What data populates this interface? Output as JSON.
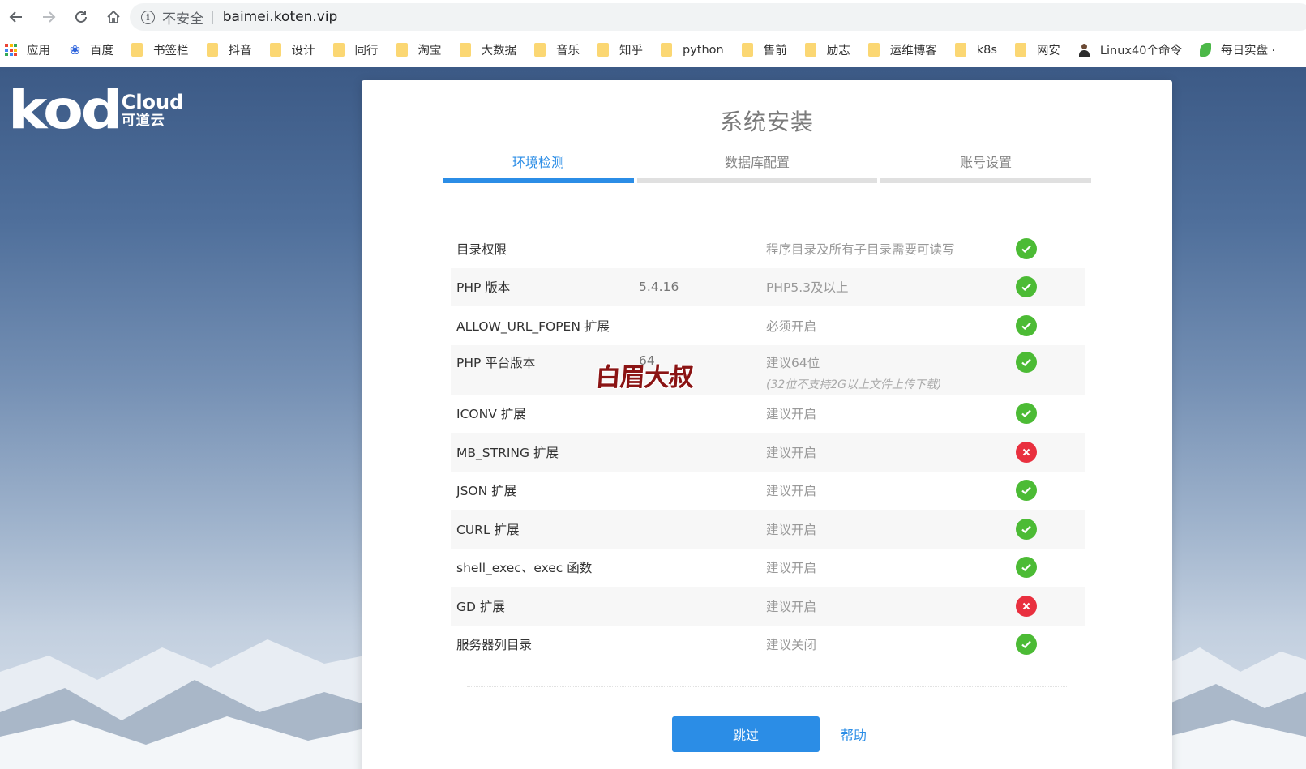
{
  "browser": {
    "insecure_label": "不安全",
    "separator": "|",
    "url": "baimei.koten.vip",
    "bookmarks": [
      {
        "label": "应用",
        "icon": "apps-grid-icon"
      },
      {
        "label": "百度",
        "icon": "baidu-paw-icon"
      },
      {
        "label": "书签栏",
        "icon": "folder-icon"
      },
      {
        "label": "抖音",
        "icon": "folder-icon"
      },
      {
        "label": "设计",
        "icon": "folder-icon"
      },
      {
        "label": "同行",
        "icon": "folder-icon"
      },
      {
        "label": "淘宝",
        "icon": "folder-icon"
      },
      {
        "label": "大数据",
        "icon": "folder-icon"
      },
      {
        "label": "音乐",
        "icon": "folder-icon"
      },
      {
        "label": "知乎",
        "icon": "folder-icon"
      },
      {
        "label": "python",
        "icon": "folder-icon"
      },
      {
        "label": "售前",
        "icon": "folder-icon"
      },
      {
        "label": "励志",
        "icon": "folder-icon"
      },
      {
        "label": "运维博客",
        "icon": "folder-icon"
      },
      {
        "label": "k8s",
        "icon": "folder-icon"
      },
      {
        "label": "网安",
        "icon": "folder-icon"
      },
      {
        "label": "Linux40个命令",
        "icon": "person-icon"
      },
      {
        "label": "每日实盘 ·",
        "icon": "leaf-icon"
      }
    ]
  },
  "logo": {
    "mark": "kod",
    "cloud": "Cloud",
    "cn": "可道云"
  },
  "installer": {
    "title": "系统安装",
    "steps": [
      {
        "label": "环境检测",
        "active": true
      },
      {
        "label": "数据库配置",
        "active": false
      },
      {
        "label": "账号设置",
        "active": false
      }
    ],
    "checks": [
      {
        "name": "目录权限",
        "value": "",
        "requirement": "程序目录及所有子目录需要可读写",
        "note": "",
        "status": "ok"
      },
      {
        "name": "PHP 版本",
        "value": "5.4.16",
        "requirement": "PHP5.3及以上",
        "note": "",
        "status": "ok"
      },
      {
        "name": "ALLOW_URL_FOPEN 扩展",
        "value": "",
        "requirement": "必须开启",
        "note": "",
        "status": "ok"
      },
      {
        "name": "PHP 平台版本",
        "value": "64",
        "requirement": "建议64位",
        "note": "(32位不支持2G以上文件上传下载)",
        "status": "ok"
      },
      {
        "name": "ICONV 扩展",
        "value": "",
        "requirement": "建议开启",
        "note": "",
        "status": "ok"
      },
      {
        "name": "MB_STRING 扩展",
        "value": "",
        "requirement": "建议开启",
        "note": "",
        "status": "fail"
      },
      {
        "name": "JSON 扩展",
        "value": "",
        "requirement": "建议开启",
        "note": "",
        "status": "ok"
      },
      {
        "name": "CURL 扩展",
        "value": "",
        "requirement": "建议开启",
        "note": "",
        "status": "ok"
      },
      {
        "name": "shell_exec、exec 函数",
        "value": "",
        "requirement": "建议开启",
        "note": "",
        "status": "ok"
      },
      {
        "name": "GD 扩展",
        "value": "",
        "requirement": "建议开启",
        "note": "",
        "status": "fail"
      },
      {
        "name": "服务器列目录",
        "value": "",
        "requirement": "建议关闭",
        "note": "",
        "status": "ok"
      }
    ],
    "skip_label": "跳过",
    "help_label": "帮助"
  },
  "watermark": "白眉大叔",
  "colors": {
    "accent": "#2b8de6",
    "ok": "#4cbb35",
    "fail": "#e9303f"
  }
}
